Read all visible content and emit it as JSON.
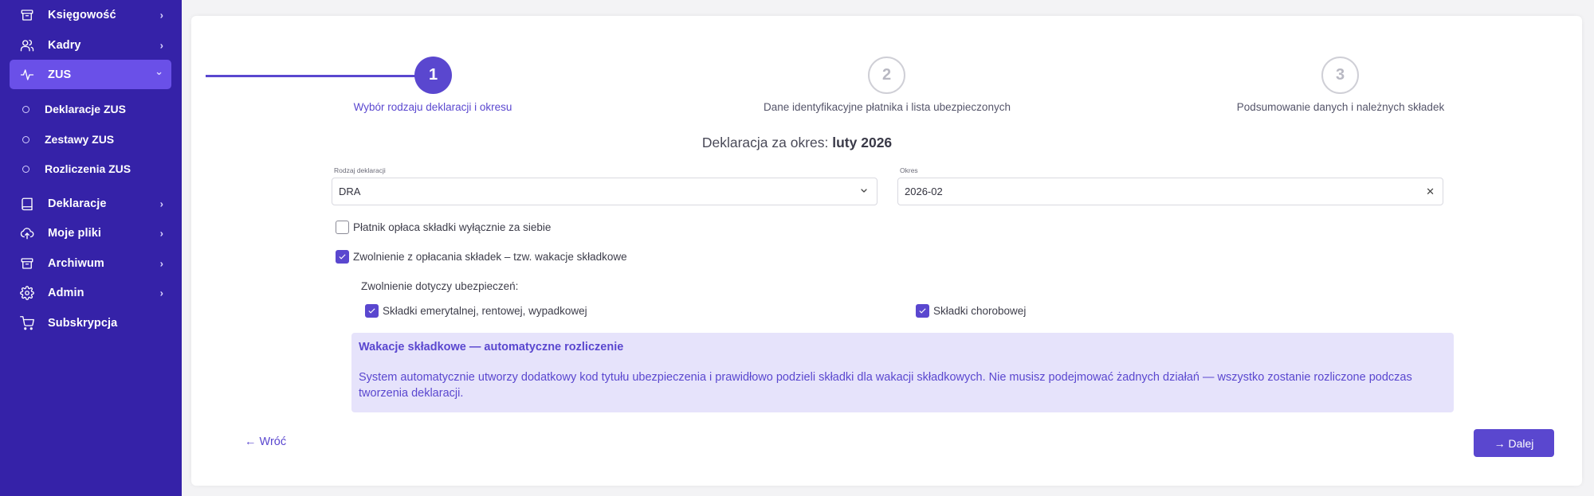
{
  "sidebar": {
    "items": [
      {
        "label": "Księgowość",
        "icon": "archive-icon",
        "chevron": "›"
      },
      {
        "label": "Kadry",
        "icon": "users-icon",
        "chevron": "›"
      },
      {
        "label": "ZUS",
        "icon": "activity-icon",
        "chevron": "⌄",
        "active": true
      },
      {
        "label": "Deklaracje",
        "icon": "book-icon",
        "chevron": "›"
      },
      {
        "label": "Moje pliki",
        "icon": "cloud-upload-icon",
        "chevron": "›"
      },
      {
        "label": "Archiwum",
        "icon": "archive-icon",
        "chevron": "›"
      },
      {
        "label": "Admin",
        "icon": "gear-icon",
        "chevron": "›"
      },
      {
        "label": "Subskrypcja",
        "icon": "cart-icon"
      }
    ],
    "zus_subitems": [
      "Deklaracje ZUS",
      "Zestawy ZUS",
      "Rozliczenia ZUS"
    ]
  },
  "stepper": {
    "steps": [
      {
        "number": "1",
        "label": "Wybór rodzaju deklaracji i okresu",
        "state": "active"
      },
      {
        "number": "2",
        "label": "Dane identyfikacyjne płatnika i lista ubezpieczonych",
        "state": "inactive"
      },
      {
        "number": "3",
        "label": "Podsumowanie danych i należnych składek",
        "state": "inactive"
      }
    ]
  },
  "heading": {
    "prefix": "Deklaracja za okres: ",
    "period": "luty 2026"
  },
  "form": {
    "declaration_type_label": "Rodzaj deklaracji",
    "declaration_type_value": "DRA",
    "period_label": "Okres",
    "period_value": "2026-02",
    "checkbox_self_only": {
      "label": "Płatnik opłaca składki wyłącznie za siebie",
      "checked": false
    },
    "checkbox_vacation": {
      "label": "Zwolnienie z opłacania składek – tzw. wakacje składkowe",
      "checked": true
    },
    "exemption_heading": "Zwolnienie dotyczy ubezpieczeń:",
    "checkbox_pension": {
      "label": "Składki emerytalnej, rentowej, wypadkowej",
      "checked": true
    },
    "checkbox_sickness": {
      "label": "Składki chorobowej",
      "checked": true
    }
  },
  "info": {
    "title": "Wakacje składkowe — automatyczne rozliczenie",
    "text": "System automatycznie utworzy dodatkowy kod tytułu ubezpieczenia i prawidłowo podzieli składki dla wakacji składkowych. Nie musisz podejmować żadnych działań — wszystko zostanie rozliczone podczas tworzenia deklaracji."
  },
  "footer": {
    "back_label": "← Wróć",
    "next_label": "→ Dalej"
  },
  "colors": {
    "sidebar_bg": "#3522a8",
    "accent": "#5a47cf",
    "info_bg": "#e6e3fb"
  }
}
